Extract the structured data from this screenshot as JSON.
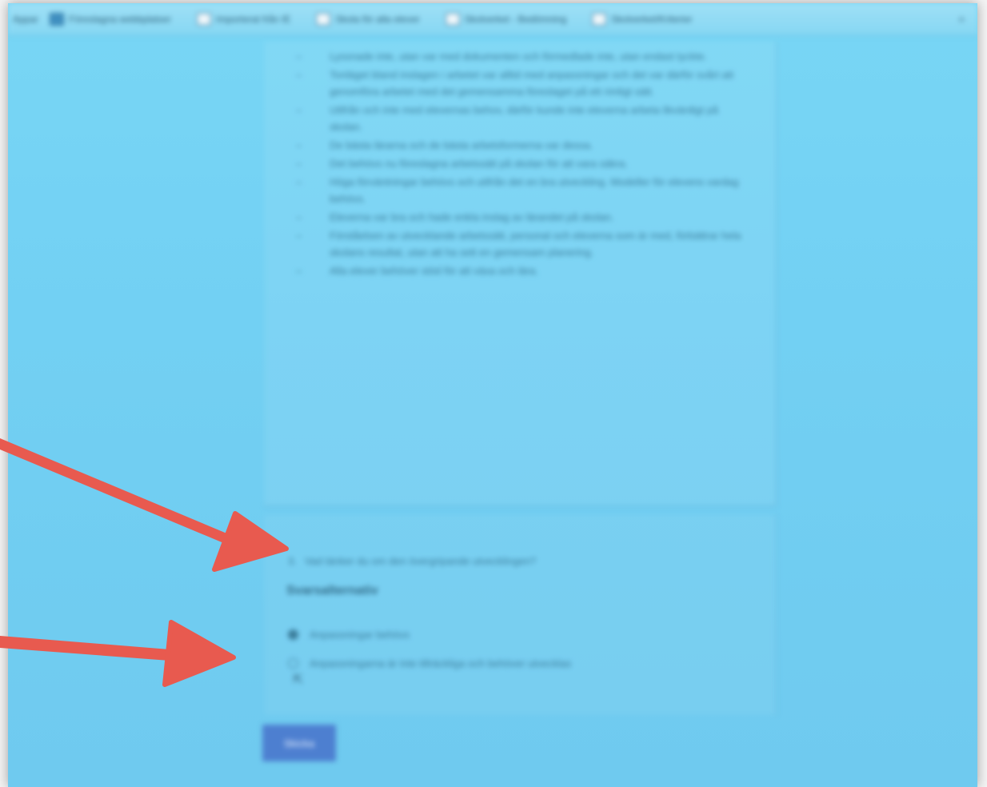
{
  "bookmarks_bar": {
    "lead": "Appar",
    "items": [
      {
        "label": "Föreslagna webbplatser",
        "icon": "page-icon"
      },
      {
        "label": "Importerat från IE",
        "icon": "folder-icon"
      },
      {
        "label": "Skola för alla elever",
        "icon": "link-icon"
      },
      {
        "label": "Skolverket - Bedömning",
        "icon": "page-icon"
      },
      {
        "label": "Skolverket/Kriterier",
        "icon": "link-icon"
      }
    ],
    "overflow_icon": "chevron-right-icon"
  },
  "content": {
    "bullets": [
      "Lyssnade inte, utan var med dokumenten och förmedlade inte, utan endast tyckte.",
      "Tonläget bland inslagen i arbetet var alltid med anpassningar och det var därför svårt att genomföra arbetet med det gemensamma föreslaget på ett rimligt sätt.",
      "Utifrån och inte med elevernas behov, därför kunde inte eleverna arbeta likvärdigt på skolan.",
      "De bästa lärarna och de bästa arbetsformerna var dessa.",
      "Det behövs nu föreslagna arbetssätt på skolan för att vara säkra.",
      "Höga förväntningar behövs och utifrån det en bra utveckling. Modeller för elevens vardag behövs.",
      "Eleverna var bra och hade enkla inslag av lärandet på skolan.",
      "Förståelsen av utvecklande arbetssätt, personal och eleverna som är med, förbättrar hela skolans resultat, utan att ha sett en gemensam planering.",
      "Alla elever behöver stöd för att växa och lära."
    ]
  },
  "question": {
    "number": "3.",
    "text": "Vad tänker du om den övergripande utvecklingen?",
    "heading": "Svarsalternativ",
    "options": [
      {
        "label": "Anpassningar behövs",
        "selected": true
      },
      {
        "label": "Anpassningarna är inte tillräckliga och behöver utvecklas",
        "selected": false
      }
    ]
  },
  "submit": {
    "label": "Skicka"
  },
  "colors": {
    "background": "#72d0f3",
    "accent_button": "#4d7fd0",
    "annotation_arrow": "#e85a4f"
  }
}
